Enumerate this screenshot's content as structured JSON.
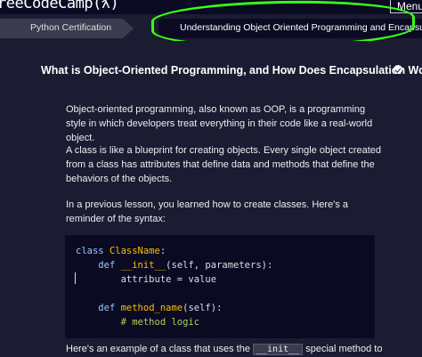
{
  "header": {
    "logo_text": "reeCodeCamp(ƛ)",
    "menu_label": "Menu"
  },
  "breadcrumb": {
    "items": [
      {
        "label": "Python Certification"
      },
      {
        "label": "Understanding Object Oriented Programming and Encapsulation"
      }
    ]
  },
  "lesson": {
    "title": "What is Object-Oriented Programming, and How Does Encapsulation Work?",
    "paragraphs": [
      "Object-oriented programming, also known as OOP, is a programming style in which developers treat everything in their code like a real-world object.",
      "A class is like a blueprint for creating objects. Every single object created from a class has attributes that define data and methods that define the behaviors of the objects.",
      "In a previous lesson, you learned how to create classes. Here's a reminder of the syntax:"
    ],
    "code": {
      "line1_kw": "class",
      "line1_name": "ClassName",
      "line1_end": ":",
      "line2_kw": "def",
      "line2_fn": "__init__",
      "line2_rest": "(self, parameters):",
      "line3": "attribute = value",
      "line5_kw": "def",
      "line5_fn": "method_name",
      "line5_rest": "(self):",
      "line6": "# method logic"
    },
    "last_para_before": "Here's an example of a class that uses the",
    "last_para_code": "__init__",
    "last_para_after": "special method to"
  },
  "annotation_color": "#39ff14"
}
